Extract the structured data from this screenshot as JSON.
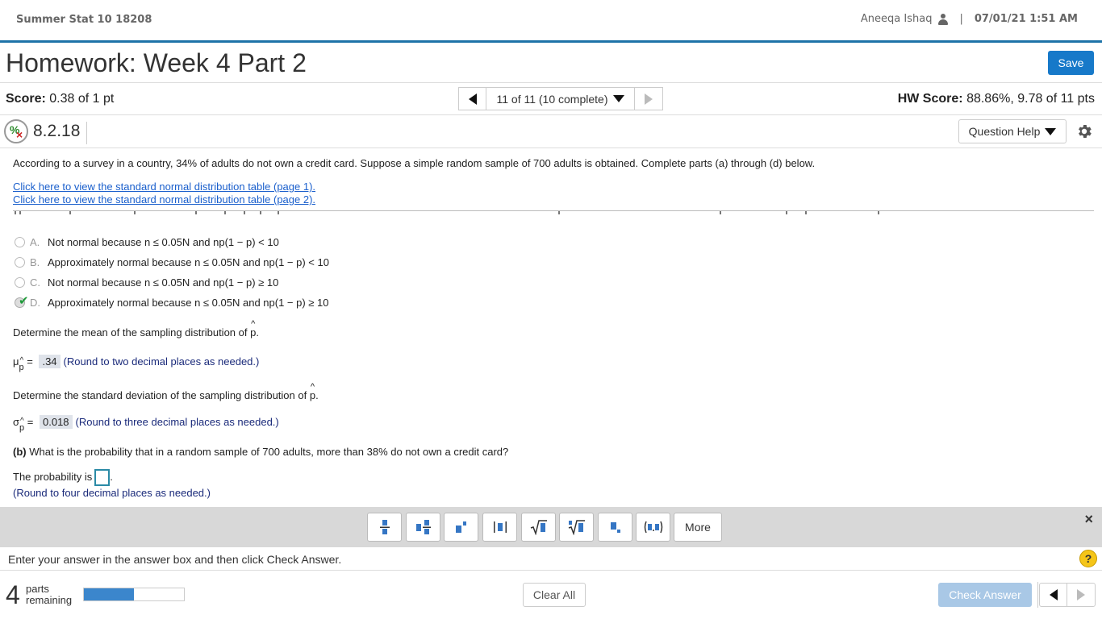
{
  "header": {
    "course": "Summer Stat 10 18208",
    "user": "Aneeqa Ishaq",
    "separator": "|",
    "datetime": "07/01/21 1:51 AM"
  },
  "title": {
    "text": "Homework: Week 4 Part 2",
    "save_label": "Save"
  },
  "score": {
    "label": "Score:",
    "value": "0.38 of 1 pt",
    "nav_label": "11 of 11 (10 complete)",
    "hw_label": "HW Score:",
    "hw_value": "88.86%, 9.78 of 11 pts"
  },
  "question": {
    "id": "8.2.18",
    "help_label": "Question Help",
    "status_icon_pct": "%",
    "status_icon_x": "×"
  },
  "content": {
    "intro": "According to a survey in a country, 34% of adults do not own a credit card. Suppose a simple random sample of 700 adults is obtained. Complete parts (a) through (d) below.",
    "link1": "Click here to view the standard normal distribution table (page 1).",
    "link2": "Click here to view the standard normal distribution table (page 2).",
    "options": [
      {
        "letter": "A.",
        "text": "Not normal because n ≤ 0.05N and np(1 − p) < 10",
        "selected": false
      },
      {
        "letter": "B.",
        "text": "Approximately normal because n ≤ 0.05N and np(1 − p) < 10",
        "selected": false
      },
      {
        "letter": "C.",
        "text": "Not normal because n ≤ 0.05N and np(1 − p) ≥ 10",
        "selected": false
      },
      {
        "letter": "D.",
        "text": "Approximately normal because n ≤ 0.05N and np(1 − p) ≥ 10",
        "selected": true
      }
    ],
    "mean_prompt": "Determine the mean of the sampling distribution of",
    "p_letter": "p",
    "period": ".",
    "mean_symbol": "μ",
    "equals": "=",
    "mean_value": ".34",
    "mean_hint": "(Round to two decimal places as needed.)",
    "sd_prompt": "Determine the standard deviation of the sampling distribution of",
    "sd_symbol": "σ",
    "sd_value": "0.018",
    "sd_hint": "(Round to three decimal places as needed.)",
    "partb_label": "(b)",
    "partb_text": "What is the probability that in a random sample of 700 adults, more than 38% do not own a credit card?",
    "prob_label": "The probability is",
    "prob_hint": "(Round to four decimal places as needed.)"
  },
  "toolbar": {
    "more_label": "More",
    "close": "×",
    "button_names": [
      "fraction",
      "mixed-number",
      "exponent",
      "absolute-value",
      "square-root",
      "nth-root",
      "subscript",
      "ordered-pair"
    ]
  },
  "footer": {
    "status": "Enter your answer in the answer box and then click Check Answer.",
    "help": "?",
    "parts_count": "4",
    "parts_label_1": "parts",
    "parts_label_2": "remaining",
    "progress": 0.5,
    "clear_label": "Clear All",
    "check_label": "Check Answer"
  },
  "colors": {
    "accent": "#1e73a8",
    "save": "#1779c9",
    "check_disabled": "#a9c8e6",
    "link": "#1a5fcc",
    "hint": "#1a2a7a",
    "correct": "#1f9a3a"
  }
}
